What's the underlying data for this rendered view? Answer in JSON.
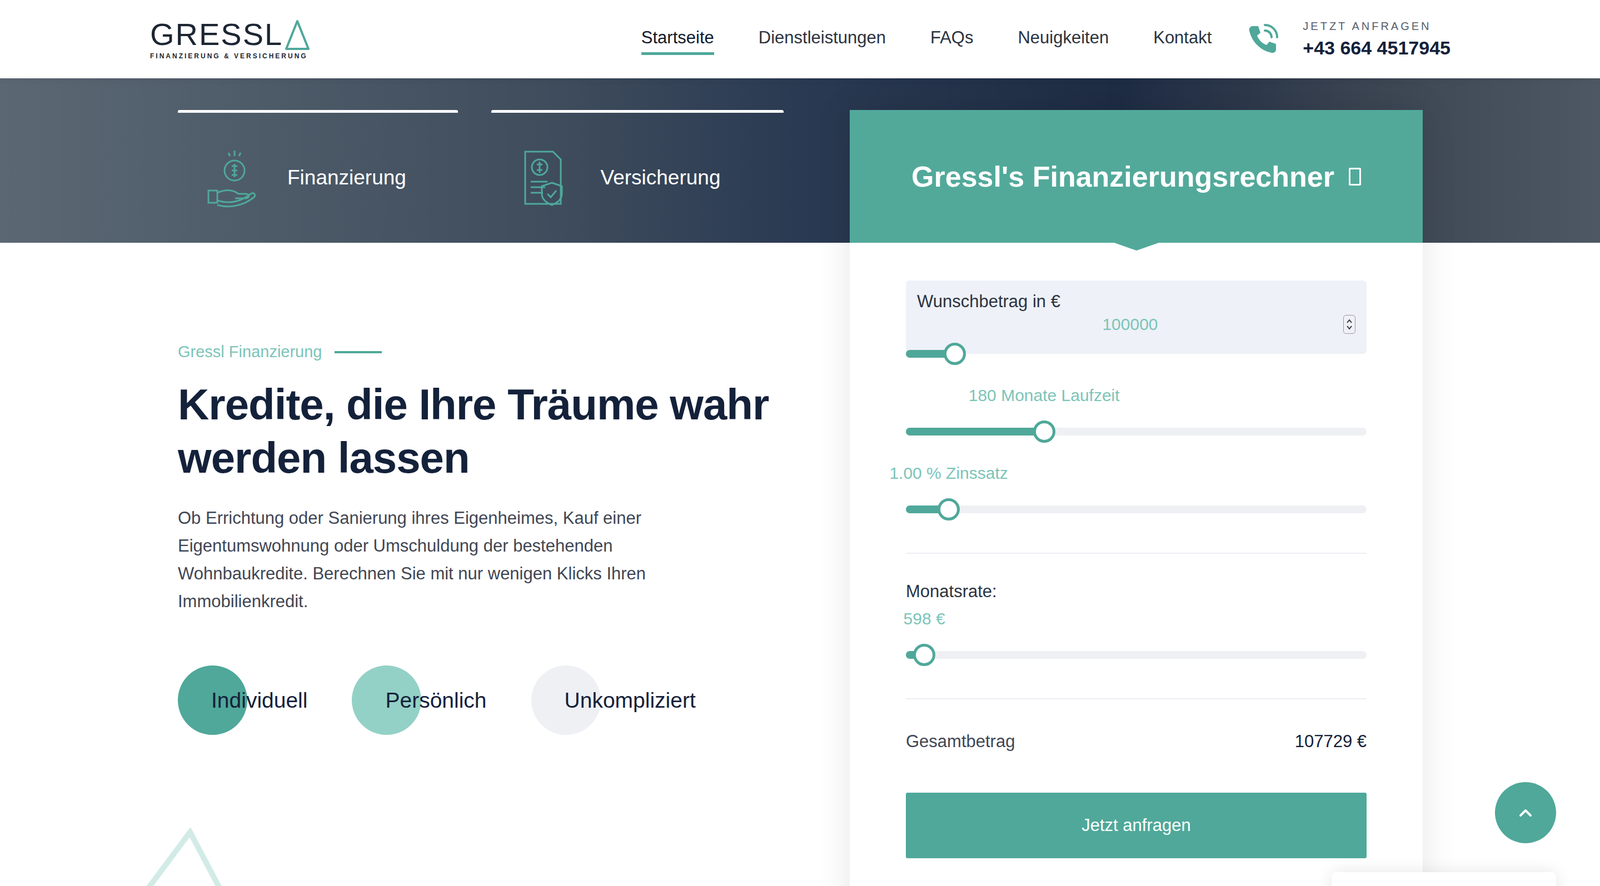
{
  "logo": {
    "name": "GRESSL",
    "tagline": "FINANZIERUNG & VERSICHERUNG"
  },
  "nav": [
    {
      "label": "Startseite",
      "selected": true
    },
    {
      "label": "Dienstleistungen",
      "selected": false
    },
    {
      "label": "FAQs",
      "selected": false
    },
    {
      "label": "Neuigkeiten",
      "selected": false
    },
    {
      "label": "Kontakt",
      "selected": false
    }
  ],
  "contact": {
    "label": "JETZT ANFRAGEN",
    "phone": "+43 664 4517945"
  },
  "hero_tabs": [
    {
      "label": "Finanzierung",
      "kind": "finance"
    },
    {
      "label": "Versicherung",
      "kind": "insurance"
    }
  ],
  "intro": {
    "eyebrow": "Gressl Finanzierung",
    "heading": "Kredite, die Ihre Träume wahr werden lassen",
    "text": "Ob Errichtung oder Sanierung ihres Eigenheimes, Kauf einer Eigentumswohnung oder Umschuldung der bestehenden Wohnbaukredite. Berechnen Sie mit nur wenigen Klicks Ihren Immobilienkredit.",
    "features": [
      {
        "label": "Individuell",
        "color": "#4fa89a"
      },
      {
        "label": "Persönlich",
        "color": "#93d1c6"
      },
      {
        "label": "Unkompliziert",
        "color": "#eef0f4"
      }
    ]
  },
  "calculator": {
    "title": "Gressl's Finanzierungsrechner",
    "amount": {
      "label": "Wunschbetrag in €",
      "value": "100000",
      "level": 0.106
    },
    "sliders": [
      {
        "label": "180 Monate Laufzeit",
        "level": 0.3
      },
      {
        "label": "1.00 % Zinssatz",
        "level": 0.093
      }
    ],
    "rate": {
      "label": "Monatsrate:",
      "value": "598 €",
      "level": 0.04
    },
    "total": {
      "label": "Gesamtbetrag",
      "value": "107729 €"
    },
    "button": "Jetzt anfragen"
  }
}
